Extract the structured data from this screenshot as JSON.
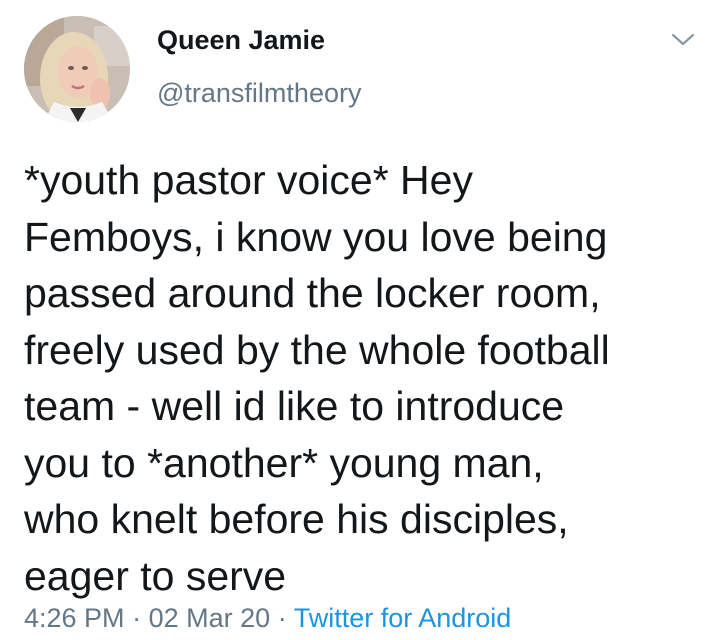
{
  "tweet": {
    "author": {
      "display_name": "Queen Jamie",
      "handle": "@transfilmtheory",
      "avatar": "profile-photo"
    },
    "menu_icon": "chevron-down-icon",
    "body_lines": [
      "*youth pastor voice* Hey",
      "Femboys, i know you love being",
      "passed around the locker room,",
      "freely used by the whole football",
      "team - well id like to introduce",
      "you to *another* young man,",
      "who knelt before his disciples,",
      "eager to serve"
    ],
    "meta": {
      "time": "4:26 PM",
      "separator": "·",
      "date": "02 Mar 20",
      "source": "Twitter for Android"
    },
    "colors": {
      "text": "#14171a",
      "secondary": "#657786",
      "link": "#1b95e0"
    }
  }
}
